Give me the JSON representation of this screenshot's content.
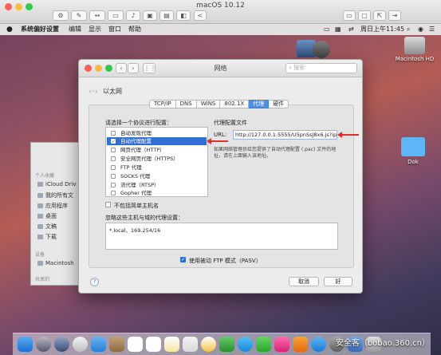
{
  "vm": {
    "title": "macOS 10.12"
  },
  "menubar": {
    "items": [
      "系统偏好设置",
      "编辑",
      "显示",
      "窗口",
      "帮助"
    ],
    "clock": "周日上午11:45"
  },
  "desktop": {
    "hd_label": "Macintosh HD",
    "folder_label": "Dok"
  },
  "finder": {
    "section_personal": "个人收藏",
    "items": [
      "iCloud Driv",
      "我的所有文",
      "应用程序",
      "桌面",
      "文稿",
      "下载"
    ],
    "section_devices": "设备",
    "device": "Macintosh",
    "section_shared": "共享的"
  },
  "window": {
    "title": "网络",
    "search_placeholder": "搜索",
    "interface": "以太网",
    "tabs": [
      "TCP/IP",
      "DNS",
      "WINS",
      "802.1X",
      "代理",
      "硬件"
    ],
    "active_tab": "代理",
    "protocol_prompt": "请选择一个协议进行配置：",
    "protocols": [
      {
        "label": "自动发现代理",
        "checked": false,
        "selected": false
      },
      {
        "label": "自动代理配置",
        "checked": true,
        "selected": true
      },
      {
        "label": "网页代理（HTTP）",
        "checked": false,
        "selected": false
      },
      {
        "label": "安全网页代理（HTTPS）",
        "checked": false,
        "selected": false
      },
      {
        "label": "FTP 代理",
        "checked": false,
        "selected": false
      },
      {
        "label": "SOCKS 代理",
        "checked": false,
        "selected": false
      },
      {
        "label": "流代理（RTSP）",
        "checked": false,
        "selected": false
      },
      {
        "label": "Gopher 代理",
        "checked": false,
        "selected": false
      }
    ],
    "config_title": "代理配置文件",
    "url_label": "URL:",
    "url_value": "http://127.0.0.1:5555/U5pnSsJ8x6.js?ip",
    "url_note_1": "如果网络管理员给您提供了自动代理配置 (.pac) 文件的地",
    "url_note_2": "址，请在上面输入该地址。",
    "exclude_simple": "不包括简单主机名",
    "bypass_label": "忽略这些主机与域的代理设置：",
    "bypass_value": "*.local、169.254/16",
    "passive_ftp": "使用被动 FTP 模式（PASV）",
    "cancel": "取消",
    "ok": "好"
  },
  "watermark": "安全客（bobao.360.cn）"
}
